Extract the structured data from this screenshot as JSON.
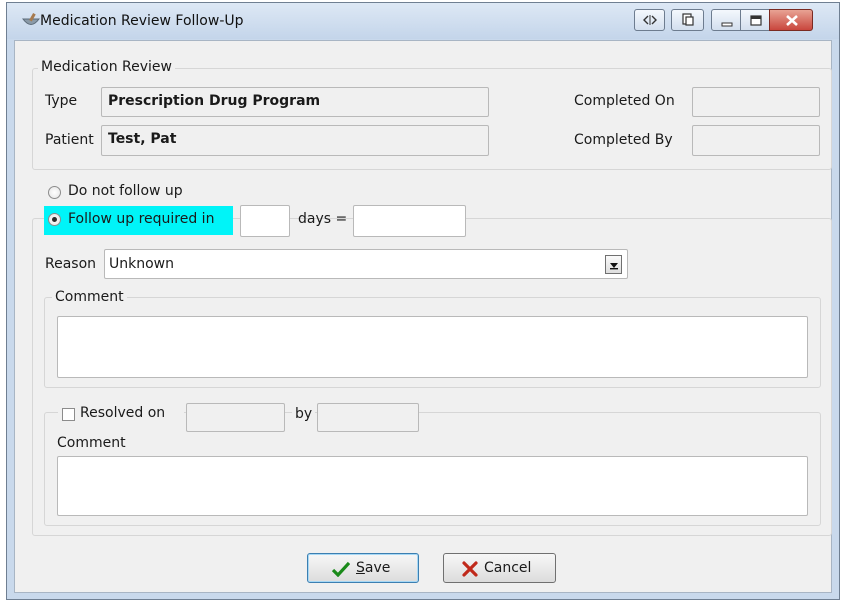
{
  "window": {
    "title": "Medication Review Follow-Up",
    "app_icon": "mortar-pestle-icon",
    "title_buttons": [
      "restore-split-icon",
      "copy-window-icon",
      "minimize-icon",
      "maximize-icon",
      "close-icon"
    ]
  },
  "medication_review": {
    "legend": "Medication Review",
    "type_label": "Type",
    "type_value": "Prescription Drug Program",
    "patient_label": "Patient",
    "patient_value": "Test, Pat",
    "completed_on_label": "Completed On",
    "completed_on_value": "",
    "completed_by_label": "Completed By",
    "completed_by_value": ""
  },
  "follow_up": {
    "no_follow_up_label": "Do not follow up",
    "follow_up_required_label": "Follow up required in",
    "follow_up_selected": true,
    "days_value": "",
    "days_label": "days =",
    "date_value": "",
    "reason_label": "Reason",
    "reason_value": "Unknown",
    "comment_legend": "Comment",
    "comment_value": ""
  },
  "resolution": {
    "resolved_label": "Resolved on",
    "resolved_checked": false,
    "resolved_on_value": "",
    "by_label": "by",
    "by_value": "",
    "comment_label": "Comment",
    "comment_value": ""
  },
  "buttons": {
    "save_label": "Save",
    "save_mnemonic": "S",
    "save_rest": "ave",
    "cancel_label": "Cancel"
  },
  "colors": {
    "highlight": "#00f4f8",
    "save_check": "#1a8a1a",
    "cancel_x": "#c0291b",
    "close_button": "#c9463d"
  }
}
